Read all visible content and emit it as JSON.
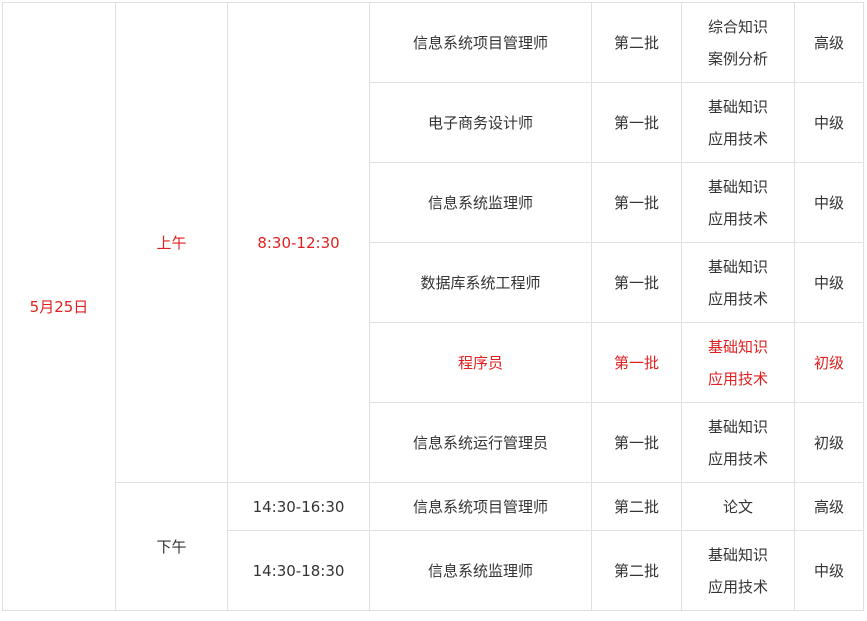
{
  "colors": {
    "highlight": "#e02020",
    "text": "#333333",
    "border": "#e0e0e0"
  },
  "schedule": {
    "date": "5月25日",
    "morning": {
      "period": "上午",
      "time": "8:30-12:30",
      "rows": [
        {
          "subject": "信息系统项目管理师",
          "batch": "第二批",
          "exam_line1": "综合知识",
          "exam_line2": "案例分析",
          "level": "高级"
        },
        {
          "subject": "电子商务设计师",
          "batch": "第一批",
          "exam_line1": "基础知识",
          "exam_line2": "应用技术",
          "level": "中级"
        },
        {
          "subject": "信息系统监理师",
          "batch": "第一批",
          "exam_line1": "基础知识",
          "exam_line2": "应用技术",
          "level": "中级"
        },
        {
          "subject": "数据库系统工程师",
          "batch": "第一批",
          "exam_line1": "基础知识",
          "exam_line2": "应用技术",
          "level": "中级"
        },
        {
          "subject": "程序员",
          "batch": "第一批",
          "exam_line1": "基础知识",
          "exam_line2": "应用技术",
          "level": "初级"
        },
        {
          "subject": "信息系统运行管理员",
          "batch": "第一批",
          "exam_line1": "基础知识",
          "exam_line2": "应用技术",
          "level": "初级"
        }
      ]
    },
    "afternoon": {
      "period": "下午",
      "rows": [
        {
          "time": "14:30-16:30",
          "subject": "信息系统项目管理师",
          "batch": "第二批",
          "exam_line1": "论文",
          "level": "高级"
        },
        {
          "time": "14:30-18:30",
          "subject": "信息系统监理师",
          "batch": "第二批",
          "exam_line1": "基础知识",
          "exam_line2": "应用技术",
          "level": "中级"
        }
      ]
    }
  }
}
